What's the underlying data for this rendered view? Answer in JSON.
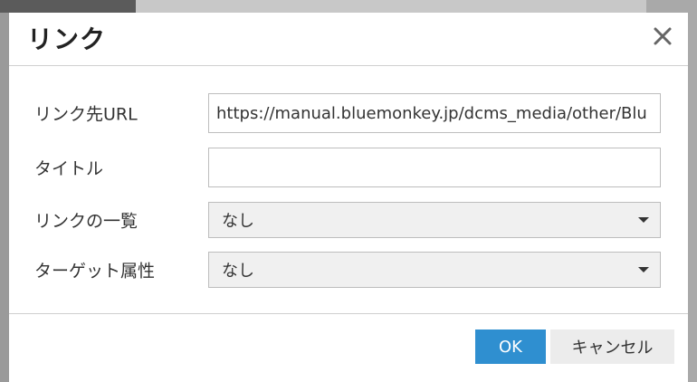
{
  "dialog": {
    "title": "リンク",
    "close_icon": "close-icon"
  },
  "form": {
    "url_label": "リンク先URL",
    "url_value": "https://manual.bluemonkey.jp/dcms_media/other/Blu",
    "title_label": "タイトル",
    "title_value": "",
    "link_list_label": "リンクの一覧",
    "link_list_selected": "なし",
    "target_label": "ターゲット属性",
    "target_selected": "なし"
  },
  "footer": {
    "ok_label": "OK",
    "cancel_label": "キャンセル"
  },
  "colors": {
    "accent": "#2f8fd0",
    "cancel_bg": "#ececec"
  }
}
